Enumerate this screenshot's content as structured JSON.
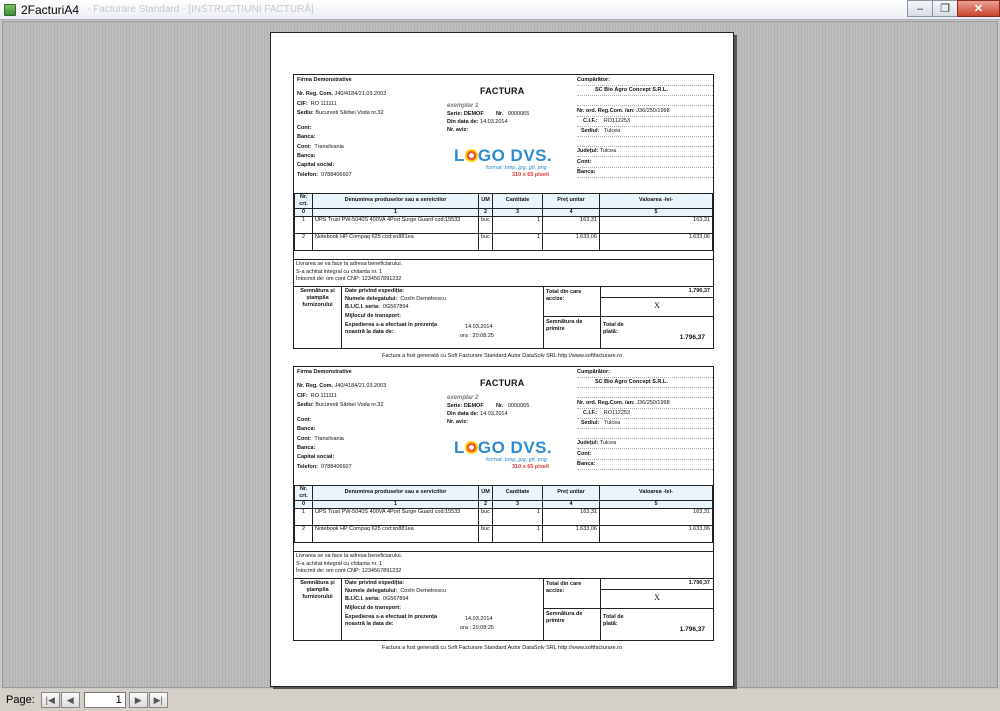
{
  "window": {
    "title": "2FacturiA4",
    "ghost_title": "- Facturare Standard - [INSTRUCȚIUNI FACTURĂ]",
    "minimize": "–",
    "maximize": "❐",
    "close": "✕"
  },
  "status": {
    "page_label": "Page:",
    "page_value": "1"
  },
  "colors": {
    "header_fill": "#eaf5fb",
    "logo_blue": "#2d8bd0",
    "logo_red": "#dd3333"
  },
  "invoice": {
    "seller": {
      "firm": "Firma Demonstrative",
      "reg_label": "Nr. Reg. Com.",
      "reg_value": "J40/4184/21.03.2003",
      "cif_label": "CIF:",
      "cif_value": "RO 111111",
      "sediu_label": "Sediu:",
      "sediu_value": "Bucuresti Sărbei Voda nr.32",
      "cont1_label": "Cont:",
      "banca1_label": "Banca:",
      "cont2_label": "Cont:",
      "cont2_value": "Transilvania",
      "banca2_label": "Banca:",
      "capital_label": "Capital social:",
      "telefon_label": "Telefon:",
      "telefon_value": "0788406607"
    },
    "title": "FACTURA",
    "serie_label": "Serie:",
    "serie_value": "DEMOF",
    "nr_label": "Nr.",
    "nr_value": "0000065",
    "din_data_label": "Din data de:",
    "din_data_value": "14.03.2014",
    "nr_aviz_label": "Nr. aviz:",
    "logo": {
      "text_a": "L",
      "text_b": "GO DVS.",
      "formats": "format: bmp, jpg, gif, png",
      "pixels": "310 x 65 pixeli"
    },
    "buyer": {
      "label": "Cumpărător:",
      "name": "SC Bio Agro Concept S.R.L.",
      "reg_label": "Nr. ord. Reg.Com. /an:",
      "reg_value": "J36/250/1998",
      "cif_label": "C.I.F.:",
      "cif_value": "RO112253",
      "sediu_label": "Sediul:",
      "sediu_value": "Tulcea",
      "judet_label": "Județul:",
      "judet_value": "Tulcea",
      "cont_label": "Cont:",
      "banca_label": "Banca:"
    },
    "table": {
      "headers": [
        "Nr. crt.",
        "Denumirea produselor sau a serviciilor",
        "UM",
        "Cantitate",
        "Preț unitar",
        "Valoarea -lei-"
      ],
      "indexes": [
        "0",
        "1",
        "2",
        "3",
        "4",
        "5"
      ],
      "rows": [
        {
          "nr": "1",
          "name": "UPS Trust PW-5040S 400VA 4Port Surge Guard cod:15533",
          "um": "buc",
          "qty": "1",
          "price": "163,31",
          "value": "163,31"
        },
        {
          "nr": "2",
          "name": "Notebook HP Compaq 625 cod:xn881ea",
          "um": "buc",
          "qty": "1",
          "price": "1.633,06",
          "value": "1.633,06"
        }
      ]
    },
    "notes": [
      "Livrarea se va face la adresa beneficiarului.",
      "S-a achitat integral cu chitanta nr. 1",
      "Întocmit de: om cont CNP: 1234567891232"
    ],
    "footer": {
      "semn_label": "Semnătura și ștampila furnizorului",
      "expedition_title": "Date privind expediția:",
      "delegat_label": "Numele delegatului:",
      "delegat_value": "Cosîn Demetrescu",
      "bi_label": "B.I./C.I. seria:",
      "bi_value": "0G567894",
      "transport_label": "Mijlocul de transport:",
      "expediere_label": "Expedierea s-a efectuat în prezența noastră la data de:",
      "expediere_date": "14.03.2014",
      "expediere_ora": "ora : 20:08:25",
      "total_label": "Total din care accize:",
      "total_value": "1.796,37",
      "accize_value": "X",
      "semn_primire": "Semnătura de primire",
      "total_plata_label": "Total de plată:",
      "total_plata_value": "1.796,37"
    },
    "generated": "Factura a fost generată cu Soft Facturare Standard Autor DataSolv SRL http://www.softfacturare.ro",
    "copies": [
      "exemplar 1",
      "exemplar 2"
    ]
  }
}
